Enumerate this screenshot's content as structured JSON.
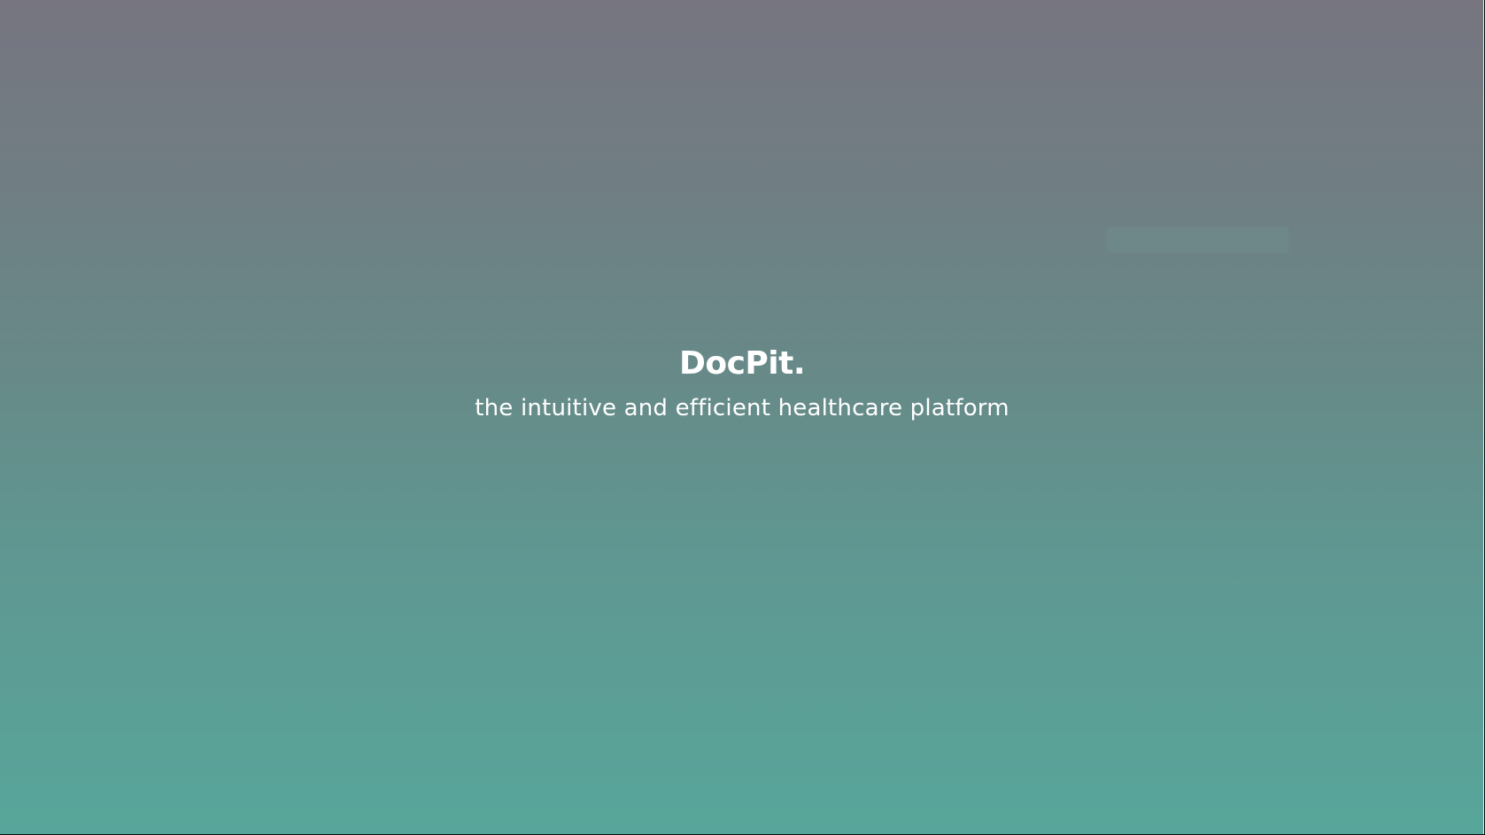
{
  "brand": {
    "title": "DocPit.",
    "tagline": "the intuitive and efficient healthcare platform"
  },
  "colors": {
    "gradient_top": "#767580",
    "gradient_bottom": "#58a69b",
    "text": "#ffffff"
  }
}
